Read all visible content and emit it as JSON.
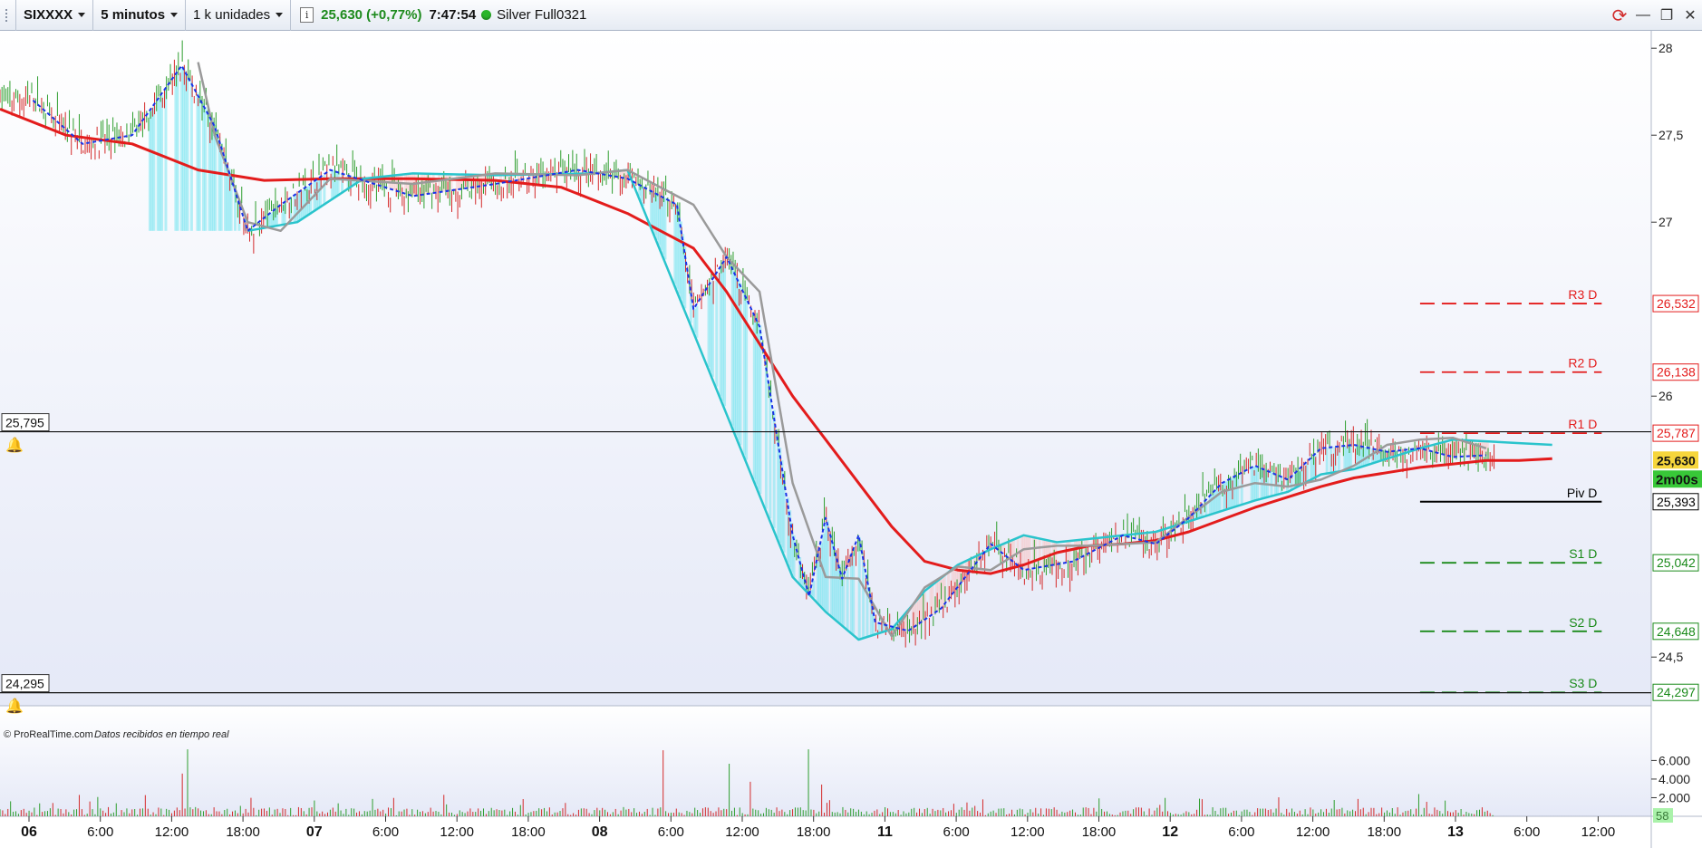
{
  "toolbar": {
    "symbol": "SIXXXX",
    "timeframe": "5 minutos",
    "units": "1 k unidades",
    "info_icon": "i",
    "price_change": "25,630 (+0,77%)",
    "time": "7:47:54",
    "feed": "Silver Full0321"
  },
  "window_controls": {
    "refresh_icon": "⟳",
    "minimize_icon": "—",
    "restore_icon": "❐",
    "close_icon": "✕"
  },
  "chart_data": [
    {
      "type": "line",
      "title": "",
      "price_scale_ticks": [
        "28",
        "27,5",
        "27",
        "26",
        "24,5"
      ],
      "time_ticks": [
        "06",
        "6:00",
        "12:00",
        "18:00",
        "07",
        "6:00",
        "12:00",
        "18:00",
        "08",
        "6:00",
        "12:00",
        "18:00",
        "11",
        "6:00",
        "12:00",
        "18:00",
        "12",
        "6:00",
        "12:00",
        "18:00",
        "13",
        "6:00",
        "12:00"
      ],
      "bold_time_ticks": [
        "06",
        "07",
        "08",
        "11",
        "12",
        "13"
      ],
      "ylim": [
        24.22,
        28.1
      ],
      "grid": false,
      "series": [
        {
          "color": "#e31c1c",
          "x": [
            0,
            0.04,
            0.08,
            0.12,
            0.16,
            0.2,
            0.25,
            0.3,
            0.34,
            0.38,
            0.42,
            0.44,
            0.46,
            0.48,
            0.5,
            0.52,
            0.54,
            0.56,
            0.58,
            0.6,
            0.62,
            0.64,
            0.66,
            0.68,
            0.7,
            0.72,
            0.74,
            0.76,
            0.78,
            0.8,
            0.82,
            0.84,
            0.86,
            0.88,
            0.9,
            0.92,
            0.94
          ],
          "values": [
            27.65,
            27.5,
            27.45,
            27.3,
            27.24,
            27.25,
            27.25,
            27.24,
            27.2,
            27.05,
            26.85,
            26.6,
            26.3,
            26.0,
            25.75,
            25.5,
            25.25,
            25.05,
            25.0,
            24.98,
            25.03,
            25.1,
            25.14,
            25.15,
            25.17,
            25.22,
            25.29,
            25.36,
            25.42,
            25.48,
            25.53,
            25.56,
            25.59,
            25.61,
            25.63,
            25.63,
            25.64
          ]
        },
        {
          "color": "#2ac4cc",
          "x": [
            0.15,
            0.18,
            0.22,
            0.25,
            0.3,
            0.36,
            0.38,
            0.48,
            0.5,
            0.52,
            0.54,
            0.56,
            0.58,
            0.6,
            0.62,
            0.64,
            0.66,
            0.7,
            0.74,
            0.76,
            0.78,
            0.8,
            0.82,
            0.84,
            0.86,
            0.88,
            0.9,
            0.92,
            0.94
          ],
          "values": [
            26.95,
            27.0,
            27.25,
            27.28,
            27.27,
            27.28,
            27.3,
            24.96,
            24.76,
            24.6,
            24.66,
            24.88,
            25.03,
            25.12,
            25.2,
            25.16,
            25.18,
            25.22,
            25.34,
            25.4,
            25.45,
            25.55,
            25.58,
            25.64,
            25.7,
            25.75,
            25.74,
            25.73,
            25.72
          ]
        },
        {
          "color": "#9a9a9a",
          "x": [
            0.12,
            0.13,
            0.15,
            0.17,
            0.2,
            0.25,
            0.3,
            0.35,
            0.38,
            0.42,
            0.44,
            0.46,
            0.48,
            0.5,
            0.52,
            0.54,
            0.56,
            0.58,
            0.6,
            0.62,
            0.64,
            0.66,
            0.7,
            0.74,
            0.76,
            0.78,
            0.8,
            0.82,
            0.84,
            0.86,
            0.88,
            0.9
          ],
          "values": [
            27.92,
            27.5,
            27.0,
            26.95,
            27.25,
            27.22,
            27.28,
            27.27,
            27.3,
            27.1,
            26.8,
            26.6,
            25.5,
            24.96,
            24.95,
            24.62,
            24.9,
            25.02,
            25.0,
            25.12,
            25.14,
            25.14,
            25.16,
            25.45,
            25.5,
            25.48,
            25.52,
            25.6,
            25.72,
            25.75,
            25.76,
            25.7
          ]
        },
        {
          "color": "#1a33e6",
          "x": [
            0.02,
            0.05,
            0.08,
            0.11,
            0.13,
            0.15,
            0.17,
            0.2,
            0.25,
            0.3,
            0.35,
            0.38,
            0.41,
            0.42,
            0.44,
            0.46,
            0.48,
            0.49,
            0.5,
            0.51,
            0.52,
            0.53,
            0.55,
            0.57,
            0.6,
            0.62,
            0.65,
            0.68,
            0.7,
            0.72,
            0.74,
            0.76,
            0.78,
            0.8,
            0.82,
            0.84,
            0.86,
            0.88,
            0.9
          ],
          "values": [
            27.7,
            27.45,
            27.5,
            27.9,
            27.55,
            26.95,
            27.1,
            27.3,
            27.15,
            27.22,
            27.3,
            27.25,
            27.1,
            26.5,
            26.8,
            26.4,
            25.2,
            24.85,
            25.3,
            24.95,
            25.2,
            24.7,
            24.65,
            24.78,
            25.15,
            25.0,
            25.05,
            25.2,
            25.15,
            25.3,
            25.5,
            25.6,
            25.52,
            25.7,
            25.72,
            25.68,
            25.7,
            25.65,
            25.66
          ]
        },
        {
          "name": "R3 D",
          "color": "#e31c1c",
          "dash": "dash",
          "x": [
            0.86,
            0.97
          ],
          "values": [
            26.532,
            26.532
          ]
        },
        {
          "name": "R2 D",
          "color": "#e31c1c",
          "dash": "dash",
          "x": [
            0.86,
            0.97
          ],
          "values": [
            26.138,
            26.138
          ]
        },
        {
          "name": "R1 D",
          "color": "#e31c1c",
          "dash": "dash",
          "x": [
            0.86,
            0.97
          ],
          "values": [
            25.787,
            25.787
          ]
        },
        {
          "name": "Piv D",
          "color": "#000000",
          "dash": "solid",
          "x": [
            0.86,
            0.97
          ],
          "values": [
            25.393,
            25.393
          ]
        },
        {
          "name": "S1 D",
          "color": "#1a8a1a",
          "dash": "dash",
          "x": [
            0.86,
            0.97
          ],
          "values": [
            25.042,
            25.042
          ]
        },
        {
          "name": "S2 D",
          "color": "#1a8a1a",
          "dash": "dash",
          "x": [
            0.86,
            0.97
          ],
          "values": [
            24.648,
            24.648
          ]
        },
        {
          "name": "S3 D",
          "color": "#1a8a1a",
          "dash": "dash",
          "x": [
            0.86,
            0.97
          ],
          "values": [
            24.297,
            24.297
          ]
        }
      ],
      "price_labels": [
        {
          "text": "26,532",
          "value": 26.532,
          "color": "#e31c1c"
        },
        {
          "text": "26,138",
          "value": 26.138,
          "color": "#e31c1c"
        },
        {
          "text": "25,787",
          "value": 25.787,
          "color": "#e31c1c"
        },
        {
          "text": "25,393",
          "value": 25.393,
          "color": "#000000"
        },
        {
          "text": "25,042",
          "value": 25.042,
          "color": "#1a8a1a"
        },
        {
          "text": "24,648",
          "value": 24.648,
          "color": "#1a8a1a"
        },
        {
          "text": "24,297",
          "value": 24.297,
          "color": "#1a8a1a"
        }
      ],
      "current_price": {
        "text": "25,630",
        "value": 25.63,
        "bg": "#f6d63c"
      },
      "countdown": {
        "text": "2m00s",
        "bg": "#38c838"
      },
      "alert_lines": [
        {
          "text": "25,795",
          "value": 25.795
        },
        {
          "text": "24,295",
          "value": 24.295
        }
      ],
      "candle_colors": {
        "up": "#2e9e2e",
        "down": "#d42a2a",
        "cloud": "#7ae6f0",
        "cloud_down": "#f8c8c8"
      }
    },
    {
      "type": "bar",
      "title": "",
      "tick_labels": [
        "6.000",
        "4.000",
        "2.000"
      ],
      "ticks": [
        6000,
        4000,
        2000
      ],
      "ylim": [
        0,
        7500
      ],
      "last_value": "58",
      "last_value_color": "#aaf2aa"
    }
  ],
  "footer": {
    "copyright": "© ProRealTime.com",
    "realtime_note": "Datos recibidos en tiempo real"
  }
}
